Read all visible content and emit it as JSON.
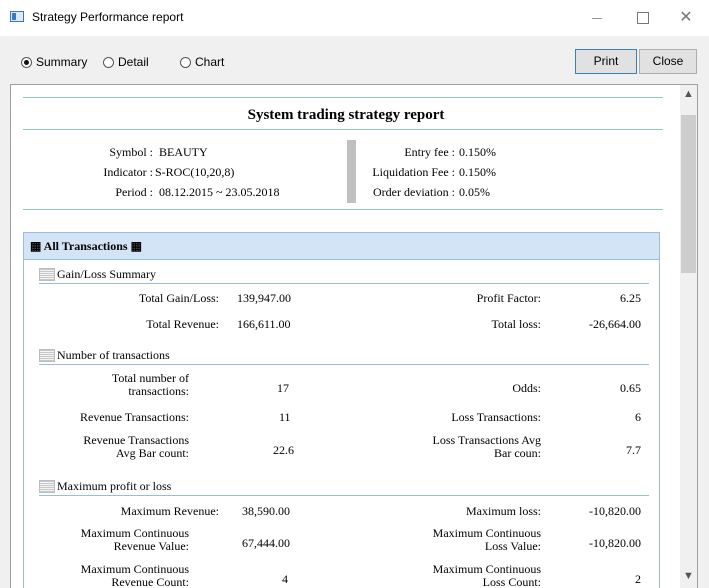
{
  "window": {
    "title": "Strategy Performance report",
    "minimize": "—",
    "maximize": "☐",
    "close": "✕"
  },
  "toolbar": {
    "options": [
      {
        "label": "Summary",
        "selected": true
      },
      {
        "label": "Detail",
        "selected": false
      },
      {
        "label": "Chart",
        "selected": false
      }
    ],
    "print_label": "Print",
    "close_label": "Close"
  },
  "report": {
    "title": "System trading strategy report",
    "symbol_label": "Symbol :",
    "symbol_value": "BEAUTY",
    "indicator_label": "Indicator :",
    "indicator_value": "S-ROC(10,20,8)",
    "period_label": "Period :",
    "period_value": "08.12.2015 ~ 23.05.2018",
    "entry_fee_label": "Entry fee :",
    "entry_fee_value": "0.150%",
    "liq_fee_label": "Liquidation Fee :",
    "liq_fee_value": "0.150%",
    "order_dev_label": "Order deviation :",
    "order_dev_value": "0.05%",
    "section_title": "▦ All Transactions ▦",
    "gain_loss_title": "Gain/Loss Summary",
    "total_gain_loss_label": "Total Gain/Loss:",
    "total_gain_loss_value": "139,947.00",
    "profit_factor_label": "Profit Factor:",
    "profit_factor_value": "6.25",
    "total_revenue_label": "Total Revenue:",
    "total_revenue_value": "166,611.00",
    "total_loss_label": "Total loss:",
    "total_loss_value": "-26,664.00",
    "num_tx_title": "Number of transactions",
    "total_num_label_1": "Total number of",
    "total_num_label_2": "transactions:",
    "total_num_value": "17",
    "odds_label": "Odds:",
    "odds_value": "0.65",
    "rev_tx_label": "Revenue Transactions:",
    "rev_tx_value": "11",
    "loss_tx_label": "Loss Transactions:",
    "loss_tx_value": "6",
    "rev_avg_label_1": "Revenue Transactions",
    "rev_avg_label_2": "Avg Bar count:",
    "rev_avg_value": "22.6",
    "loss_avg_label_1": "Loss Transactions Avg",
    "loss_avg_label_2": "Bar coun:",
    "loss_avg_value": "7.7",
    "max_pl_title": "Maximum profit or loss",
    "max_rev_label": "Maximum Revenue:",
    "max_rev_value": "38,590.00",
    "max_loss_label": "Maximum loss:",
    "max_loss_value": "-10,820.00",
    "max_cont_rev_label_1": "Maximum Continuous",
    "max_cont_rev_label_2": "Revenue Value:",
    "max_cont_rev_value": "67,444.00",
    "max_cont_loss_label_1": "Maximum Continuous",
    "max_cont_loss_label_2": "Loss Value:",
    "max_cont_loss_value": "-10,820.00",
    "max_cont_rev_cnt_label_1": "Maximum Continuous",
    "max_cont_rev_cnt_label_2": "Revenue Count:",
    "max_cont_rev_cnt_value": "4",
    "max_cont_loss_cnt_label_1": "Maximum Continuous",
    "max_cont_loss_cnt_label_2": "Loss Count:",
    "max_cont_loss_cnt_value": "2"
  },
  "scroll": {
    "up": "▲",
    "down": "▼"
  }
}
